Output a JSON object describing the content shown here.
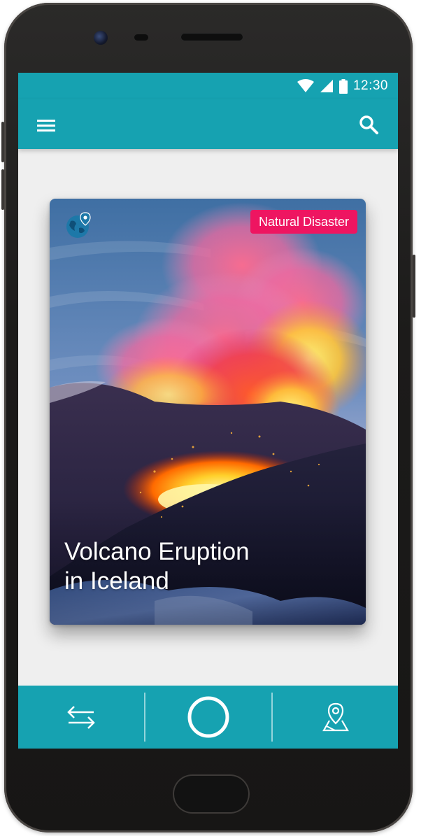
{
  "status_bar": {
    "time": "12:30",
    "icons": [
      "wifi-icon",
      "cellular-signal-icon",
      "battery-icon"
    ]
  },
  "app_bar": {
    "icons": [
      "menu-icon",
      "search-icon"
    ]
  },
  "card": {
    "category": "Natural Disaster",
    "title_line1": "Volcano Eruption",
    "title_line2": "in Iceland",
    "icon": "globe-pin-icon"
  },
  "bottom_nav": {
    "icons": [
      "swap-arrows-icon",
      "circle-home-icon",
      "map-pin-icon"
    ]
  },
  "colors": {
    "primary": "#16a2b1",
    "badge": "#ee1561",
    "screen_background": "#efefef",
    "text_on_primary": "#ffffff"
  }
}
